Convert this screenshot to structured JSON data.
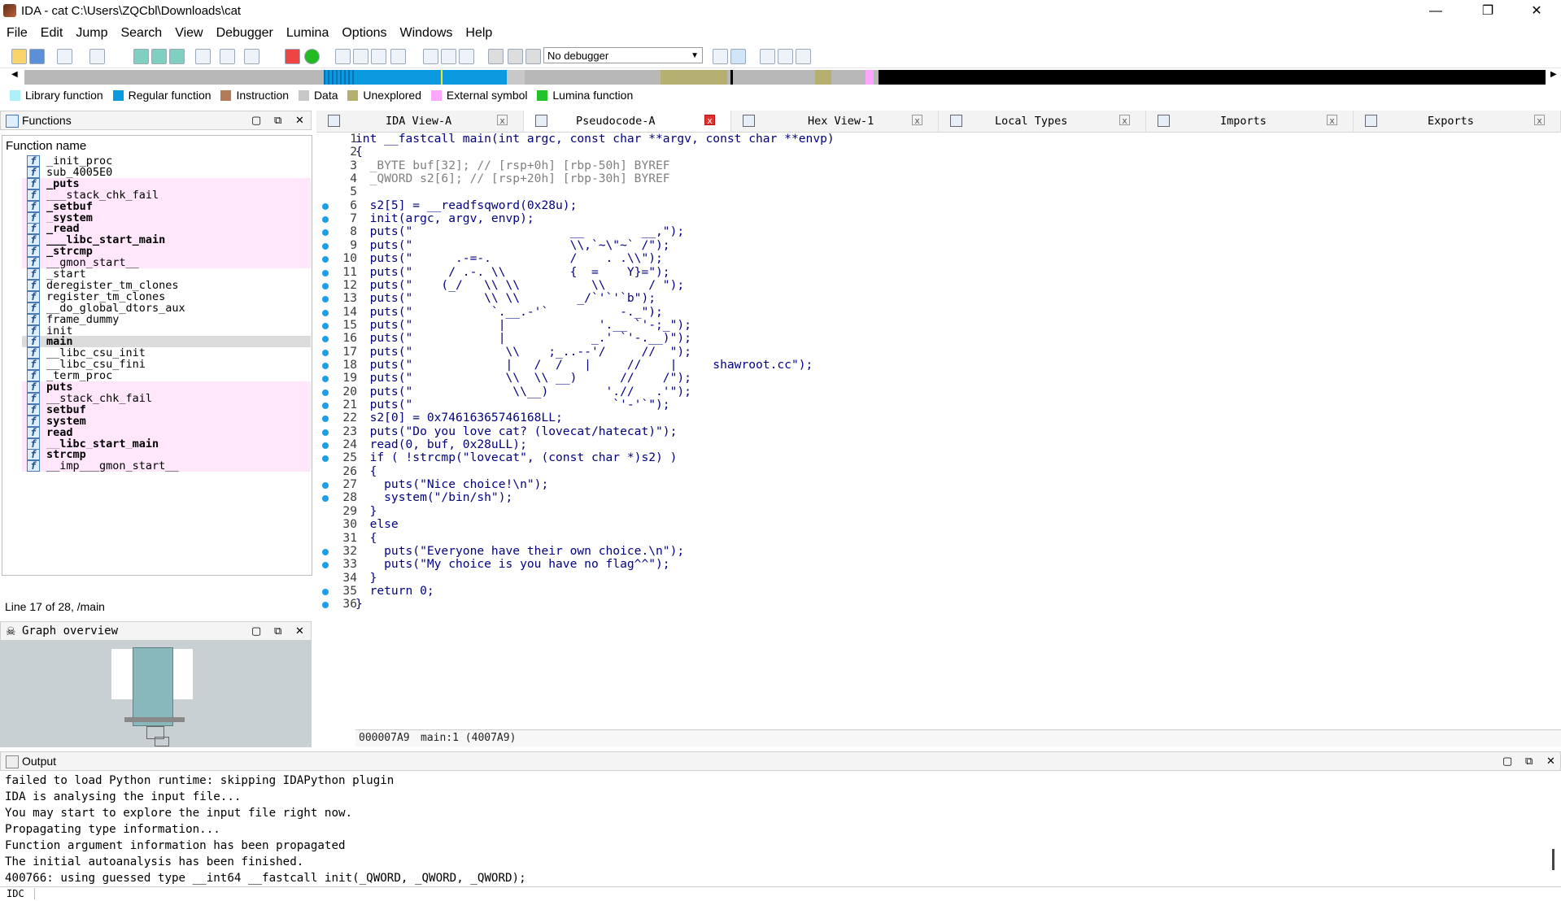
{
  "window": {
    "title": "IDA - cat C:\\Users\\ZQCbl\\Downloads\\cat"
  },
  "menu": [
    "File",
    "Edit",
    "Jump",
    "Search",
    "View",
    "Debugger",
    "Lumina",
    "Options",
    "Windows",
    "Help"
  ],
  "toolbar": {
    "debugger_value": "No debugger"
  },
  "legend": [
    {
      "label": "Library function",
      "color": "#aef0f8"
    },
    {
      "label": "Regular function",
      "color": "#0a9ae0"
    },
    {
      "label": "Instruction",
      "color": "#b47a5a"
    },
    {
      "label": "Data",
      "color": "#c8c8c8"
    },
    {
      "label": "Unexplored",
      "color": "#b5b070"
    },
    {
      "label": "External symbol",
      "color": "#ffa6ff"
    },
    {
      "label": "Lumina function",
      "color": "#22c22a"
    }
  ],
  "functions": {
    "title": "Functions",
    "column": "Function name",
    "items": [
      {
        "name": "_init_proc",
        "style": "normal"
      },
      {
        "name": "sub_4005E0",
        "style": "normal"
      },
      {
        "name": "_puts",
        "style": "lib-bold"
      },
      {
        "name": "___stack_chk_fail",
        "style": "lib"
      },
      {
        "name": "_setbuf",
        "style": "lib-bold"
      },
      {
        "name": "_system",
        "style": "lib-bold"
      },
      {
        "name": "_read",
        "style": "lib-bold"
      },
      {
        "name": "___libc_start_main",
        "style": "lib-bold"
      },
      {
        "name": "_strcmp",
        "style": "lib-bold"
      },
      {
        "name": "__gmon_start__",
        "style": "lib"
      },
      {
        "name": "_start",
        "style": "normal"
      },
      {
        "name": "deregister_tm_clones",
        "style": "normal"
      },
      {
        "name": "register_tm_clones",
        "style": "normal"
      },
      {
        "name": "__do_global_dtors_aux",
        "style": "normal"
      },
      {
        "name": "frame_dummy",
        "style": "normal"
      },
      {
        "name": "init",
        "style": "normal"
      },
      {
        "name": "main",
        "style": "selected-bold"
      },
      {
        "name": "__libc_csu_init",
        "style": "normal"
      },
      {
        "name": "__libc_csu_fini",
        "style": "normal"
      },
      {
        "name": "_term_proc",
        "style": "normal"
      },
      {
        "name": "puts",
        "style": "lib-bold"
      },
      {
        "name": "__stack_chk_fail",
        "style": "lib"
      },
      {
        "name": "setbuf",
        "style": "lib-bold"
      },
      {
        "name": "system",
        "style": "lib-bold"
      },
      {
        "name": "read",
        "style": "lib-bold"
      },
      {
        "name": "__libc_start_main",
        "style": "lib-bold"
      },
      {
        "name": "strcmp",
        "style": "lib-bold"
      },
      {
        "name": "__imp___gmon_start__",
        "style": "lib"
      }
    ],
    "status": "Line 17 of 28, /main"
  },
  "graph_overview": {
    "title": "Graph overview"
  },
  "tabs": [
    {
      "label": "IDA View-A"
    },
    {
      "label": "Pseudocode-A"
    },
    {
      "label": "Hex View-1"
    },
    {
      "label": "Local Types"
    },
    {
      "label": "Imports"
    },
    {
      "label": "Exports"
    }
  ],
  "code": {
    "lines": [
      {
        "n": "1",
        "t": "int __fastcall main(int argc, const char **argv, const char **envp)",
        "dot": false,
        "cls": "navy"
      },
      {
        "n": "2",
        "t": "{",
        "dot": false,
        "cls": "navy"
      },
      {
        "n": "3",
        "t": "  _BYTE buf[32]; // [rsp+0h] [rbp-50h] BYREF",
        "dot": false,
        "cls": "cm"
      },
      {
        "n": "4",
        "t": "  _QWORD s2[6]; // [rsp+20h] [rbp-30h] BYREF",
        "dot": false,
        "cls": "cm"
      },
      {
        "n": "5",
        "t": "",
        "dot": false,
        "cls": ""
      },
      {
        "n": "6",
        "t": "  s2[5] = __readfsqword(0x28u);",
        "dot": true,
        "cls": "navy"
      },
      {
        "n": "7",
        "t": "  init(argc, argv, envp);",
        "dot": true,
        "cls": "navy"
      },
      {
        "n": "8",
        "t": "  puts(\"                      __        __,\");",
        "dot": true,
        "cls": "navy"
      },
      {
        "n": "9",
        "t": "  puts(\"                      \\\\,`~\\\"~` /\");",
        "dot": true,
        "cls": "navy"
      },
      {
        "n": "10",
        "t": "  puts(\"      .-=-.           /    . .\\\\\");",
        "dot": true,
        "cls": "navy"
      },
      {
        "n": "11",
        "t": "  puts(\"     / .-. \\\\         {  =    Y}=\");",
        "dot": true,
        "cls": "navy"
      },
      {
        "n": "12",
        "t": "  puts(\"    (_/   \\\\ \\\\          \\\\      / \");",
        "dot": true,
        "cls": "navy"
      },
      {
        "n": "13",
        "t": "  puts(\"          \\\\ \\\\        _/`'`'`b\");",
        "dot": true,
        "cls": "navy"
      },
      {
        "n": "14",
        "t": "  puts(\"           `.__.-'`          -._\");",
        "dot": true,
        "cls": "navy"
      },
      {
        "n": "15",
        "t": "  puts(\"            |             '.__ `'-;_\");",
        "dot": true,
        "cls": "navy"
      },
      {
        "n": "16",
        "t": "  puts(\"            |            _.' `'-.__)\");",
        "dot": true,
        "cls": "navy"
      },
      {
        "n": "17",
        "t": "  puts(\"             \\\\    ;_..--'/     //  \");",
        "dot": true,
        "cls": "navy"
      },
      {
        "n": "18",
        "t": "  puts(\"             |   /  /   |     //    |     shawroot.cc\");",
        "dot": true,
        "cls": "navy"
      },
      {
        "n": "19",
        "t": "  puts(\"             \\\\  \\\\ __)      //    /\");",
        "dot": true,
        "cls": "navy"
      },
      {
        "n": "20",
        "t": "  puts(\"              \\\\__)        './/   .'\");",
        "dot": true,
        "cls": "navy"
      },
      {
        "n": "21",
        "t": "  puts(\"                            `'-'`\");",
        "dot": true,
        "cls": "navy"
      },
      {
        "n": "22",
        "t": "  s2[0] = 0x74616365746168LL;",
        "dot": true,
        "cls": "navy"
      },
      {
        "n": "23",
        "t": "  puts(\"Do you love cat? (lovecat/hatecat)\");",
        "dot": true,
        "cls": "navy"
      },
      {
        "n": "24",
        "t": "  read(0, buf, 0x28uLL);",
        "dot": true,
        "cls": "navy"
      },
      {
        "n": "25",
        "t": "  if ( !strcmp(\"lovecat\", (const char *)s2) )",
        "dot": true,
        "cls": "navy"
      },
      {
        "n": "26",
        "t": "  {",
        "dot": false,
        "cls": "navy"
      },
      {
        "n": "27",
        "t": "    puts(\"Nice choice!\\n\");",
        "dot": true,
        "cls": "navy"
      },
      {
        "n": "28",
        "t": "    system(\"/bin/sh\");",
        "dot": true,
        "cls": "navy"
      },
      {
        "n": "29",
        "t": "  }",
        "dot": false,
        "cls": "navy"
      },
      {
        "n": "30",
        "t": "  else",
        "dot": false,
        "cls": "navy"
      },
      {
        "n": "31",
        "t": "  {",
        "dot": false,
        "cls": "navy"
      },
      {
        "n": "32",
        "t": "    puts(\"Everyone have their own choice.\\n\");",
        "dot": true,
        "cls": "navy"
      },
      {
        "n": "33",
        "t": "    puts(\"My choice is you have no flag^^\");",
        "dot": true,
        "cls": "navy"
      },
      {
        "n": "34",
        "t": "  }",
        "dot": false,
        "cls": "navy"
      },
      {
        "n": "35",
        "t": "  return 0;",
        "dot": true,
        "cls": "navy"
      },
      {
        "n": "36",
        "t": "}",
        "dot": true,
        "cls": "navy"
      }
    ],
    "status_addr": "000007A9",
    "status_loc": "main:1 (4007A9)"
  },
  "output": {
    "title": "Output",
    "lines": [
      "failed to load Python runtime: skipping IDAPython plugin",
      "IDA is analysing the input file...",
      "You may start to explore the input file right now.",
      "Propagating type information...",
      "Function argument information has been propagated",
      "The initial autoanalysis has been finished.",
      "400766: using guessed type __int64 __fastcall init(_QWORD, _QWORD, _QWORD);"
    ]
  },
  "bottombar": {
    "lang": "IDC"
  }
}
